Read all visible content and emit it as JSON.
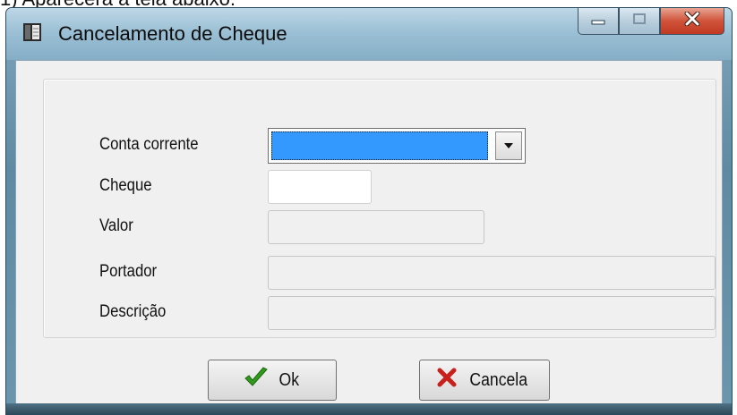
{
  "page_caption": "1) Aparecerá a tela abaixo:",
  "window": {
    "title": "Cancelamento de Cheque",
    "icons": {
      "app": "book-icon",
      "minimize": "minimize-icon",
      "maximize": "maximize-icon",
      "close": "close-icon"
    }
  },
  "form": {
    "conta_corrente": {
      "label": "Conta corrente",
      "value": ""
    },
    "cheque": {
      "label": "Cheque",
      "value": ""
    },
    "valor": {
      "label": "Valor",
      "value": ""
    },
    "portador": {
      "label": "Portador",
      "value": ""
    },
    "descricao": {
      "label": "Descrição",
      "value": ""
    }
  },
  "buttons": {
    "ok": {
      "label": "Ok",
      "icon": "checkmark-icon"
    },
    "cancel": {
      "label": "Cancela",
      "icon": "cross-icon"
    }
  },
  "colors": {
    "selection": "#3399ff",
    "close_button": "#c9442c",
    "check_green": "#2f9a1c",
    "cross_red": "#c8201a"
  }
}
